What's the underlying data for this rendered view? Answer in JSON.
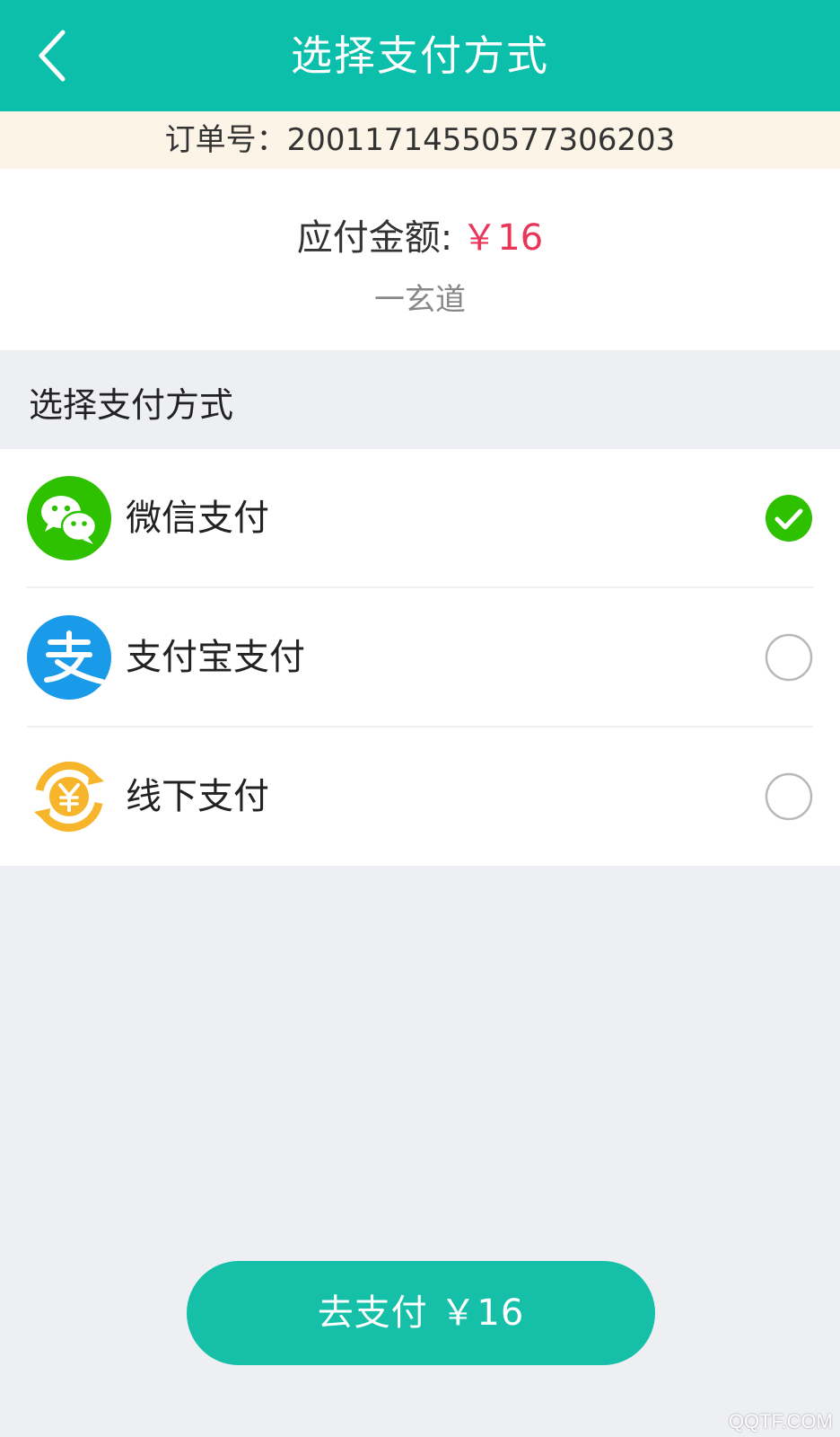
{
  "header": {
    "title": "选择支付方式",
    "back_icon": "chevron-left-icon",
    "color": "#0bbfaa"
  },
  "order": {
    "label": "订单号：",
    "number": "20011714550577306203"
  },
  "amount": {
    "label": "应付金额:",
    "value": "￥16",
    "merchant": "一玄道",
    "value_color": "#e8365a"
  },
  "section": {
    "title": "选择支付方式"
  },
  "methods": [
    {
      "label": "微信支付",
      "icon": "wechat-icon",
      "selected": true,
      "color": "#2dc100"
    },
    {
      "label": "支付宝支付",
      "icon": "alipay-icon",
      "selected": false,
      "color": "#1a9bea"
    },
    {
      "label": "线下支付",
      "icon": "yuan-coin-icon",
      "selected": false,
      "color": "#f7b52c"
    }
  ],
  "pay_button": {
    "label": "去支付 ￥16"
  },
  "watermark": "QQTF.COM"
}
